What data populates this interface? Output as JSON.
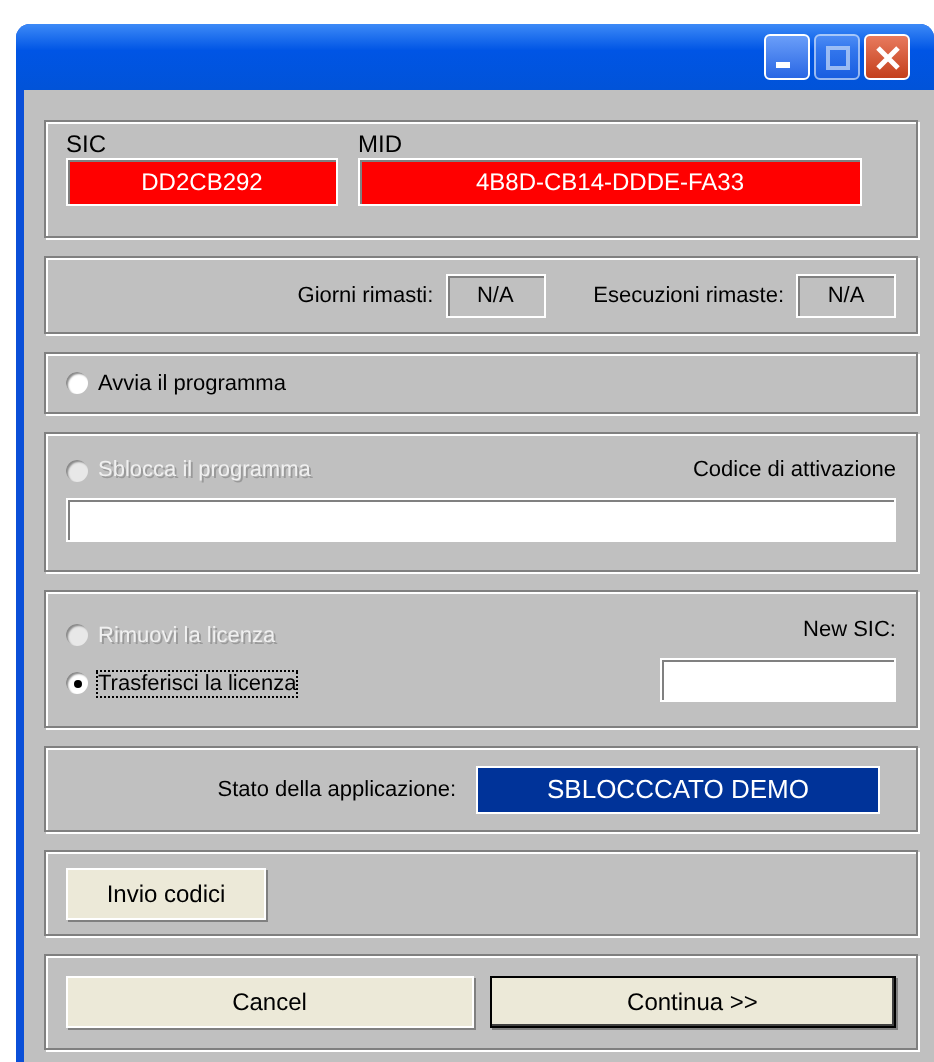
{
  "window": {
    "controls": [
      {
        "kind": "minimize",
        "disabled": false
      },
      {
        "kind": "maximize",
        "disabled": true
      },
      {
        "kind": "close",
        "disabled": false
      }
    ]
  },
  "ids": [
    {
      "label": "SIC",
      "value": "DD2CB292"
    },
    {
      "label": "MID",
      "value": "4B8D-CB14-DDDE-FA33"
    }
  ],
  "counters": [
    {
      "label": "Giorni rimasti:",
      "value": "N/A"
    },
    {
      "label": "Esecuzioni rimaste:",
      "value": "N/A"
    }
  ],
  "start": {
    "label": "Avvia il programma",
    "selected": false,
    "disabled": false
  },
  "unlock": {
    "label": "Sblocca il programma",
    "selected": false,
    "disabled": true,
    "field_label": "Codice di attivazione"
  },
  "license": {
    "options": [
      {
        "label": "Rimuovi la licenza",
        "selected": false,
        "disabled": true
      },
      {
        "label": "Trasferisci la licenza",
        "selected": true,
        "disabled": false
      }
    ],
    "field_label": "New SIC:"
  },
  "status": {
    "label": "Stato della applicazione:",
    "value": "SBLOCCCATO DEMO"
  },
  "send_button": "Invio codici",
  "buttons": [
    {
      "label": "Cancel",
      "default": false
    },
    {
      "label": "Continua >>",
      "default": true
    }
  ]
}
